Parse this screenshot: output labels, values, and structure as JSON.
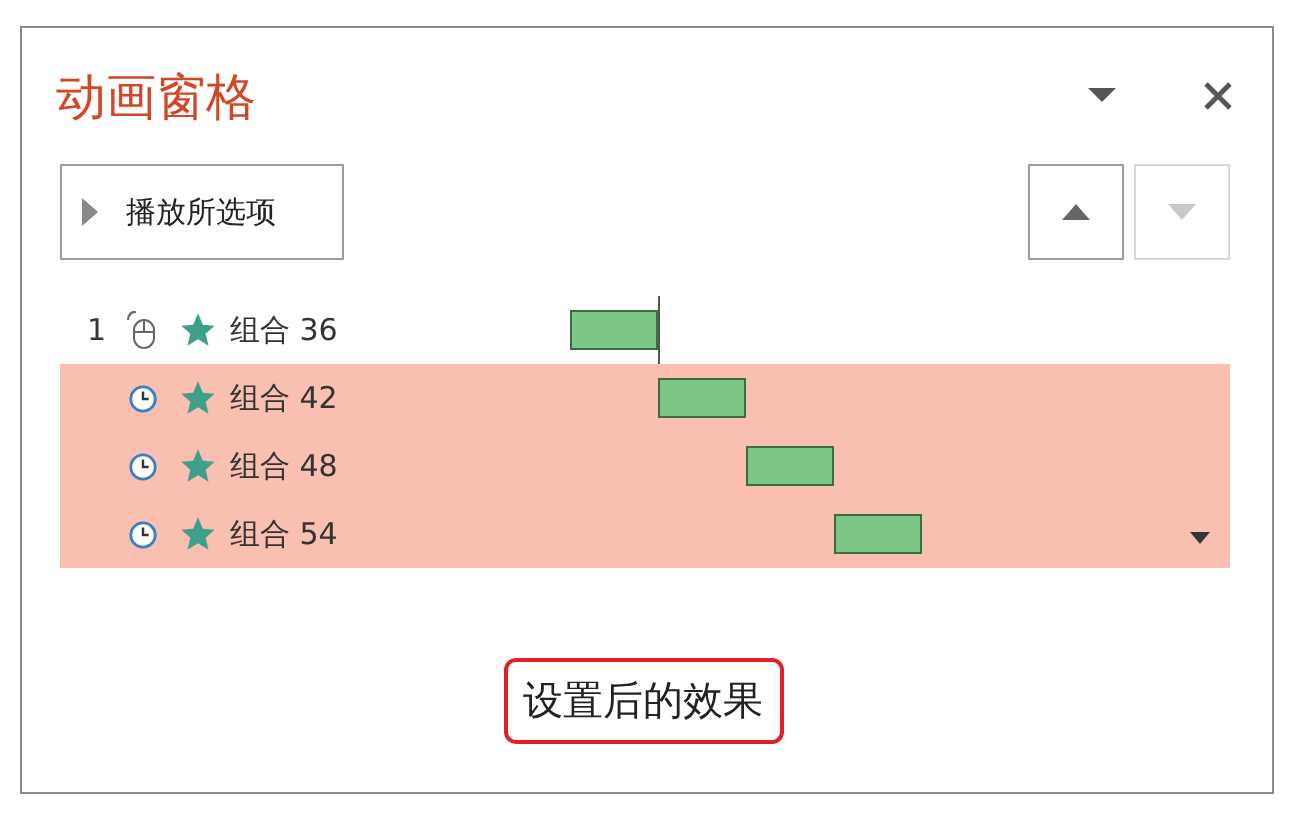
{
  "pane": {
    "title": "动画窗格"
  },
  "play_button": {
    "label": "播放所选项"
  },
  "move_up": {
    "disabled": false
  },
  "move_down": {
    "disabled": true
  },
  "animations": [
    {
      "number": "1",
      "kind": "click",
      "name": "组合 36",
      "selected": false,
      "menu_arrow": false
    },
    {
      "kind": "after",
      "name": "组合 42",
      "selected": true,
      "menu_arrow": false
    },
    {
      "kind": "after",
      "name": "组合 48",
      "selected": true,
      "menu_arrow": false
    },
    {
      "kind": "after",
      "name": "组合 54",
      "selected": true,
      "menu_arrow": true
    }
  ],
  "caption": "设置后的效果"
}
